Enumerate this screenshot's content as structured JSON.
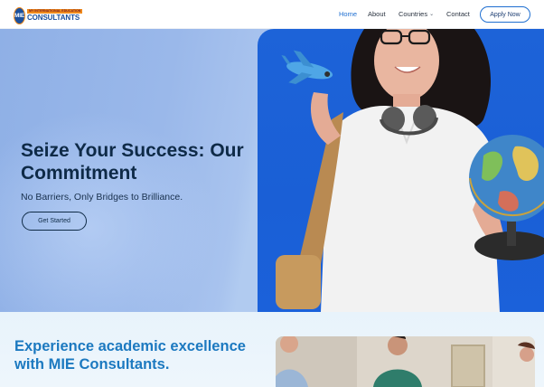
{
  "logo": {
    "mark": "MIE",
    "tagline": "MY INTERNATIONAL EDUCATION",
    "name": "CONSULTANTS"
  },
  "nav": {
    "items": [
      {
        "label": "Home",
        "active": true
      },
      {
        "label": "About",
        "active": false
      },
      {
        "label": "Countries",
        "active": false,
        "has_dropdown": true
      },
      {
        "label": "Contact",
        "active": false
      }
    ],
    "cta": "Apply Now"
  },
  "hero": {
    "title": "Seize Your Success: Our Commitment",
    "subtitle": "No Barriers, Only Bridges to Brilliance.",
    "button": "Get Started"
  },
  "section2": {
    "title": "Experience academic excellence with MIE Consultants."
  },
  "colors": {
    "accent": "#1f6fd1",
    "heading_dark": "#0e2a47",
    "heading_blue": "#1c79c0",
    "hero_photo_bg": "#1d63d8"
  }
}
